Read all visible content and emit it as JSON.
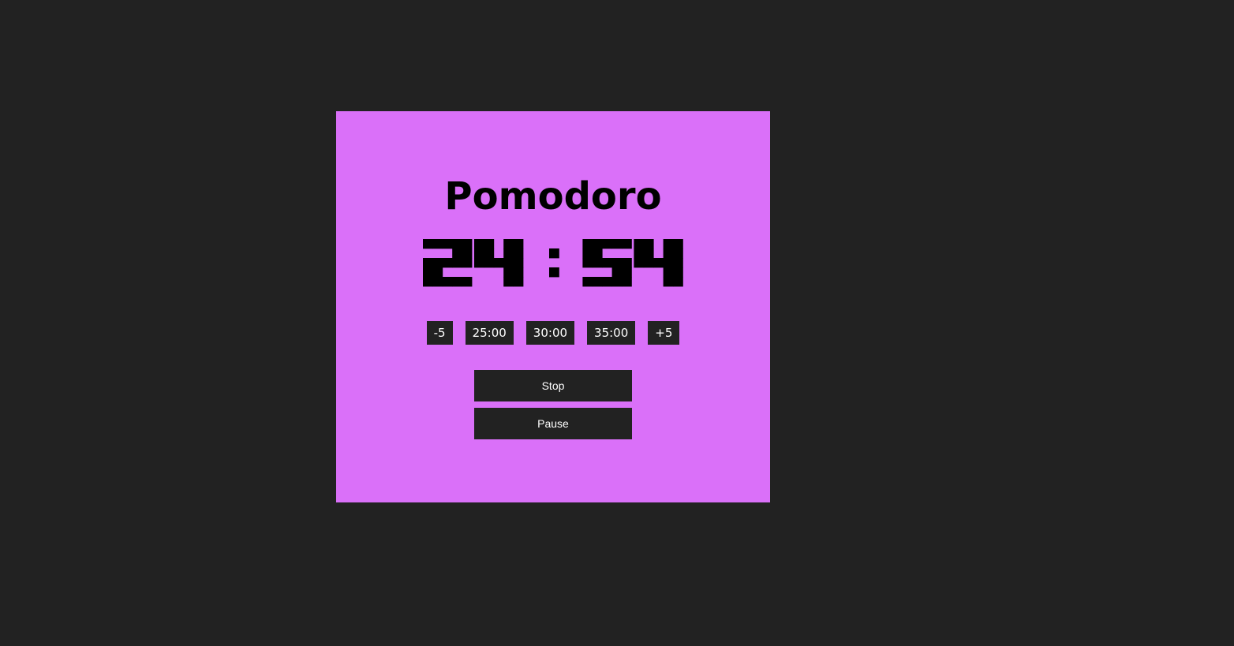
{
  "app": {
    "title": "Pomodoro",
    "colors": {
      "page_background": "#222222",
      "card_background": "#da70f9",
      "button_background": "#222222",
      "button_text": "#ffffff",
      "text": "#000000"
    }
  },
  "timer": {
    "display": "24:54"
  },
  "presets": [
    {
      "label": "-5"
    },
    {
      "label": "25:00"
    },
    {
      "label": "30:00"
    },
    {
      "label": "35:00"
    },
    {
      "label": "+5"
    }
  ],
  "actions": {
    "stop_label": "Stop",
    "pause_label": "Pause"
  }
}
